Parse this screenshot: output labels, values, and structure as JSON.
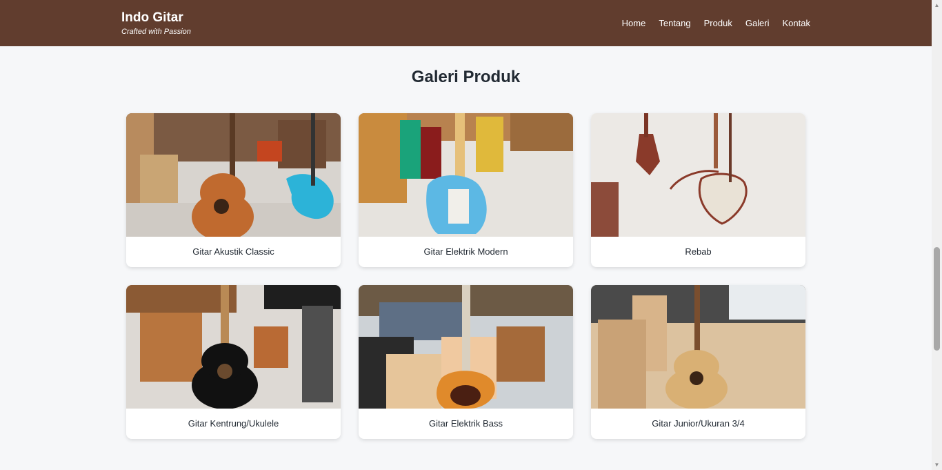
{
  "brand": {
    "title": "Indo Gitar",
    "tagline": "Crafted with Passion"
  },
  "nav": {
    "items": [
      "Home",
      "Tentang",
      "Produk",
      "Galeri",
      "Kontak"
    ]
  },
  "gallery": {
    "title": "Galeri Produk",
    "items": [
      {
        "caption": "Gitar Akustik Classic",
        "photo": "acoustic-guitar-store-photo"
      },
      {
        "caption": "Gitar Elektrik Modern",
        "photo": "electric-guitar-store-photo"
      },
      {
        "caption": "Rebab",
        "photo": "rebab-photo"
      },
      {
        "caption": "Gitar Kentrung/Ukulele",
        "photo": "ukulele-wall-photo"
      },
      {
        "caption": "Gitar Elektrik Bass",
        "photo": "bass-guitar-store-photo"
      },
      {
        "caption": "Gitar Junior/Ukuran 3/4",
        "photo": "junior-guitar-photo"
      }
    ]
  },
  "colors": {
    "navbar": "#613d2e",
    "background": "#f6f7f9",
    "heading": "#222a33",
    "card": "#ffffff"
  }
}
